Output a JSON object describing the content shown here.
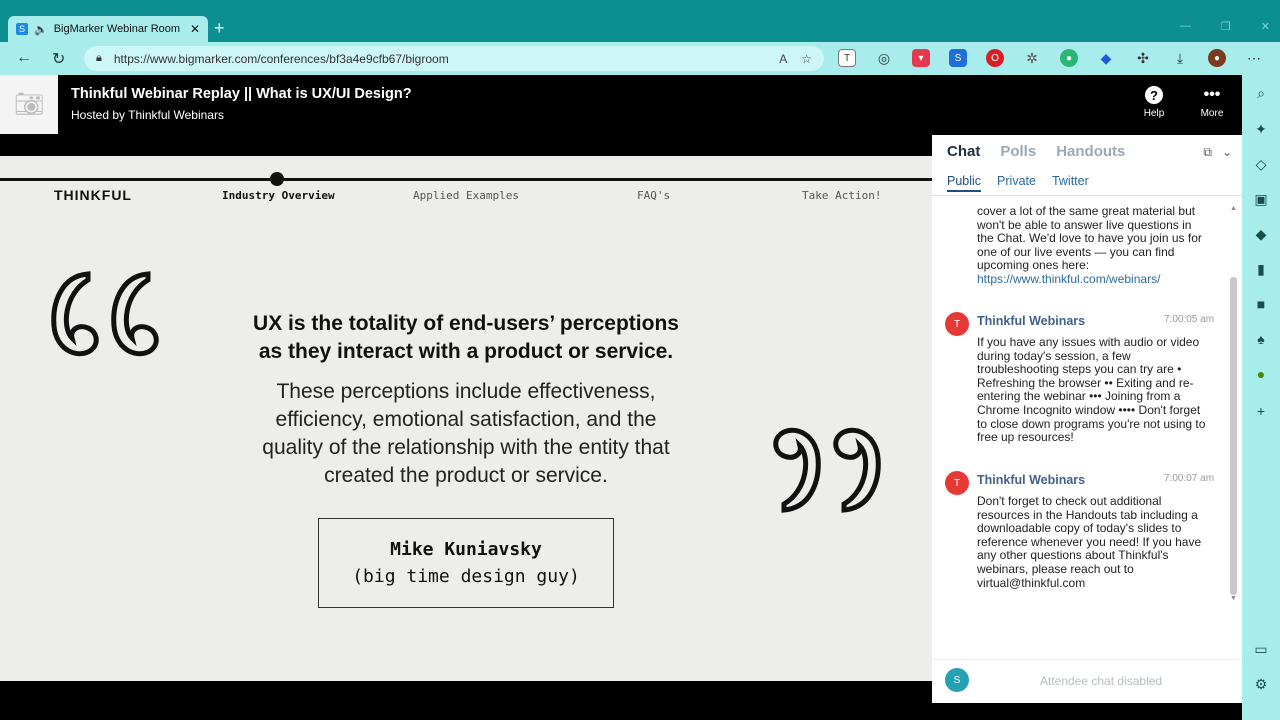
{
  "browser": {
    "tab_title": "BigMarker Webinar Room",
    "tab_favicon": "S",
    "url": "https://www.bigmarker.com/conferences/bf3a4e9cfb67/bigroom"
  },
  "header": {
    "title": "Thinkful Webinar Replay || What is UX/UI Design?",
    "host": "Hosted by Thinkful Webinars",
    "help_label": "Help",
    "more_label": "More"
  },
  "slide": {
    "brand": "THINKFUL",
    "nav": [
      "Industry Overview",
      "Applied Examples",
      "FAQ's",
      "Take Action!"
    ],
    "active_nav_index": 0,
    "quote_main_1": "UX is the totality of end-users’ perceptions",
    "quote_main_2": "as they interact with a product or service.",
    "quote_sub_1": "These perceptions include effectiveness,",
    "quote_sub_2": "efficiency, emotional satisfaction, and the",
    "quote_sub_3": "quality of the relationship with the entity that",
    "quote_sub_4": "created the product or service.",
    "attribution_name": "Mike Kuniavsky",
    "attribution_role": "(big time design guy)"
  },
  "chat": {
    "tabs": [
      "Chat",
      "Polls",
      "Handouts"
    ],
    "subtabs": [
      "Public",
      "Private",
      "Twitter"
    ],
    "partial_message_lines": [
      "cover a lot of the same great material but",
      "won't be able to answer live questions in",
      "the Chat. We'd love to have you join us for",
      "one of our live events — you can find",
      "upcoming ones here:"
    ],
    "partial_message_link": "https://www.thinkful.com/webinars/",
    "messages": [
      {
        "avatar": "T",
        "sender": "Thinkful Webinars",
        "time": "7:00:05 am",
        "lines": [
          "If you have any issues with audio or video",
          "during today's session, a few",
          "troubleshooting steps you can try are •",
          "Refreshing the browser •• Exiting and re-",
          "entering the webinar ••• Joining from a",
          "Chrome Incognito window •••• Don't forget",
          "to close down programs you're not using to",
          "free up resources!"
        ]
      },
      {
        "avatar": "T",
        "sender": "Thinkful Webinars",
        "time": "7:00:07 am",
        "lines": [
          "Don't forget to check out additional",
          "resources in the Handouts tab including a",
          "downloadable copy of today's slides to",
          "reference whenever you need! If you have",
          "any other questions about Thinkful's",
          "webinars, please reach out to",
          "virtual@thinkful.com"
        ]
      }
    ],
    "self_avatar": "S",
    "disabled_text": "Attendee chat disabled"
  },
  "colors": {
    "browser_chrome": "#0d8f8f",
    "tab_active": "#a8ecec",
    "slide_bg": "#ededeb",
    "sender": "#40618a",
    "avatar": "#e53935",
    "self_avatar": "#26a1b3"
  }
}
